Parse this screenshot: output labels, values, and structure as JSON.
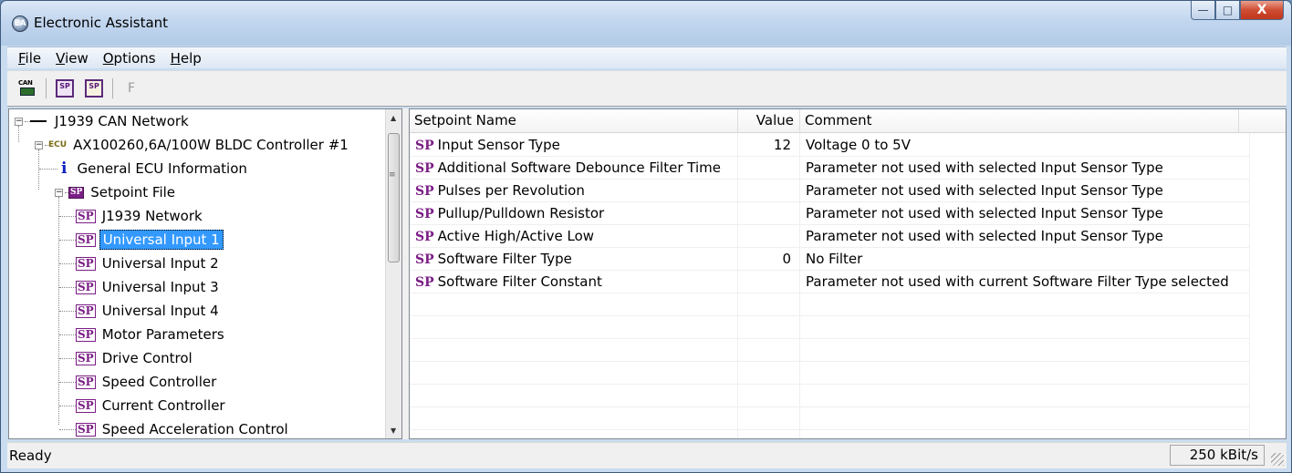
{
  "window": {
    "title": "Electronic Assistant",
    "app_icon_text": "EA",
    "controls": {
      "minimize": "—",
      "maximize": "□",
      "close": "X"
    }
  },
  "menubar": {
    "items": [
      {
        "label": "File",
        "accel": "F",
        "rest": "ile"
      },
      {
        "label": "View",
        "accel": "V",
        "rest": "iew"
      },
      {
        "label": "Options",
        "accel": "O",
        "rest": "ptions"
      },
      {
        "label": "Help",
        "accel": "H",
        "rest": "elp"
      }
    ]
  },
  "toolbar": {
    "buttons": [
      {
        "name": "can-network-icon",
        "text": "CAN"
      },
      {
        "name": "sp-open-icon",
        "text": "SP"
      },
      {
        "name": "sp-save-icon",
        "text": "SP"
      },
      {
        "name": "flash-icon",
        "text": "F"
      }
    ]
  },
  "tree": {
    "root": {
      "label": "J1939 CAN Network",
      "expander": "−"
    },
    "ecu": {
      "tag": "ECU",
      "label": "AX100260,6A/100W BLDC Controller #1",
      "expander": "−"
    },
    "general": {
      "icon": "i",
      "label": "General ECU Information"
    },
    "setpoint_file": {
      "badge": "SP",
      "label": "Setpoint File",
      "expander": "−"
    },
    "items": [
      {
        "badge": "SP",
        "label": "J1939 Network",
        "selected": false
      },
      {
        "badge": "SP",
        "label": "Universal Input 1",
        "selected": true
      },
      {
        "badge": "SP",
        "label": "Universal Input 2",
        "selected": false
      },
      {
        "badge": "SP",
        "label": "Universal Input 3",
        "selected": false
      },
      {
        "badge": "SP",
        "label": "Universal Input 4",
        "selected": false
      },
      {
        "badge": "SP",
        "label": "Motor Parameters",
        "selected": false
      },
      {
        "badge": "SP",
        "label": "Drive Control",
        "selected": false
      },
      {
        "badge": "SP",
        "label": "Speed Controller",
        "selected": false
      },
      {
        "badge": "SP",
        "label": "Current Controller",
        "selected": false
      },
      {
        "badge": "SP",
        "label": "Speed Acceleration Control",
        "selected": false
      }
    ],
    "scroll": {
      "up": "▲",
      "down": "▼",
      "grip": "≡"
    }
  },
  "list": {
    "columns": {
      "name": "Setpoint Name",
      "value": "Value",
      "comment": "Comment"
    },
    "rows": [
      {
        "tag": "SP",
        "name": "Input Sensor Type",
        "value": "12",
        "comment": "Voltage 0 to 5V"
      },
      {
        "tag": "SP",
        "name": "Additional Software Debounce Filter Time",
        "value": "",
        "comment": "Parameter not used with selected Input Sensor Type"
      },
      {
        "tag": "SP",
        "name": "Pulses per Revolution",
        "value": "",
        "comment": "Parameter not used with selected Input Sensor Type"
      },
      {
        "tag": "SP",
        "name": "Pullup/Pulldown Resistor",
        "value": "",
        "comment": "Parameter not used with selected Input Sensor Type"
      },
      {
        "tag": "SP",
        "name": "Active High/Active Low",
        "value": "",
        "comment": "Parameter not used with selected Input Sensor Type"
      },
      {
        "tag": "SP",
        "name": "Software Filter Type",
        "value": "0",
        "comment": "No Filter"
      },
      {
        "tag": "SP",
        "name": "Software Filter Constant",
        "value": "",
        "comment": "Parameter not used with current Software Filter Type selected"
      }
    ]
  },
  "statusbar": {
    "text": "Ready",
    "baud": "250 kBit/s"
  }
}
